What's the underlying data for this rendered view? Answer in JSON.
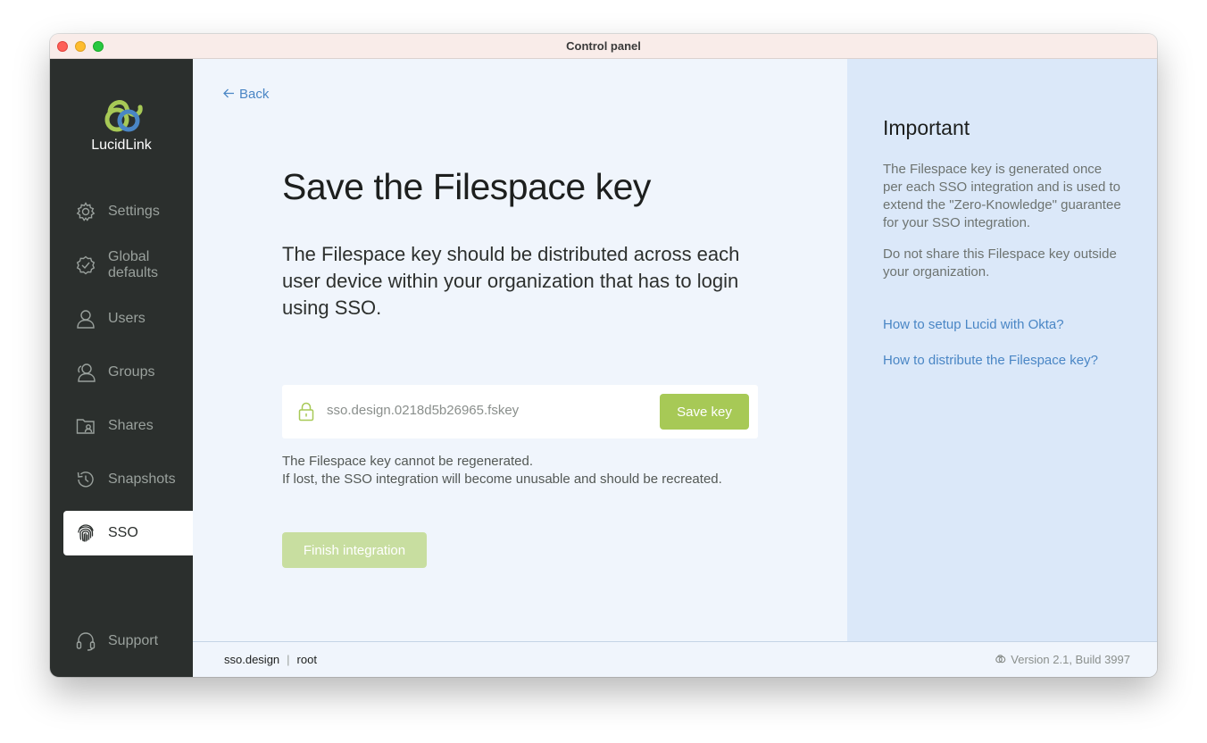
{
  "window": {
    "title": "Control panel"
  },
  "brand": {
    "name": "LucidLink",
    "colors": {
      "green": "#a7c956",
      "blue": "#4a86c5",
      "sidebar": "#2b2f2d"
    }
  },
  "sidebar": {
    "items": [
      {
        "label": "Settings",
        "icon": "gear-icon"
      },
      {
        "label": "Global defaults",
        "icon": "badge-check-icon"
      },
      {
        "label": "Users",
        "icon": "user-icon"
      },
      {
        "label": "Groups",
        "icon": "group-icon"
      },
      {
        "label": "Shares",
        "icon": "folder-share-icon"
      },
      {
        "label": "Snapshots",
        "icon": "history-icon"
      },
      {
        "label": "SSO",
        "icon": "fingerprint-icon",
        "active": true
      }
    ],
    "support": {
      "label": "Support",
      "icon": "headset-icon"
    }
  },
  "main": {
    "back_label": "Back",
    "title": "Save the Filespace key",
    "description": "The Filespace key should be distributed across each user device within your organization that has to login using SSO.",
    "key": {
      "filename": "sso.design.0218d5b26965.fskey",
      "save_label": "Save key"
    },
    "note_line1": "The Filespace key cannot be regenerated.",
    "note_line2": "If lost, the SSO integration will become unusable and should be recreated.",
    "finish_label": "Finish integration"
  },
  "aside": {
    "title": "Important",
    "paragraph1": "The Filespace key is generated once per each SSO integration and is used to extend the \"Zero-Knowledge\" guarantee for your SSO integration.",
    "paragraph2": "Do not share this Filespace key outside your organization.",
    "links": [
      "How to setup Lucid with Okta?",
      "How to distribute the Filespace key?"
    ]
  },
  "footer": {
    "filespace": "sso.design",
    "separator": "|",
    "user": "root",
    "version": "Version 2.1, Build 3997"
  }
}
